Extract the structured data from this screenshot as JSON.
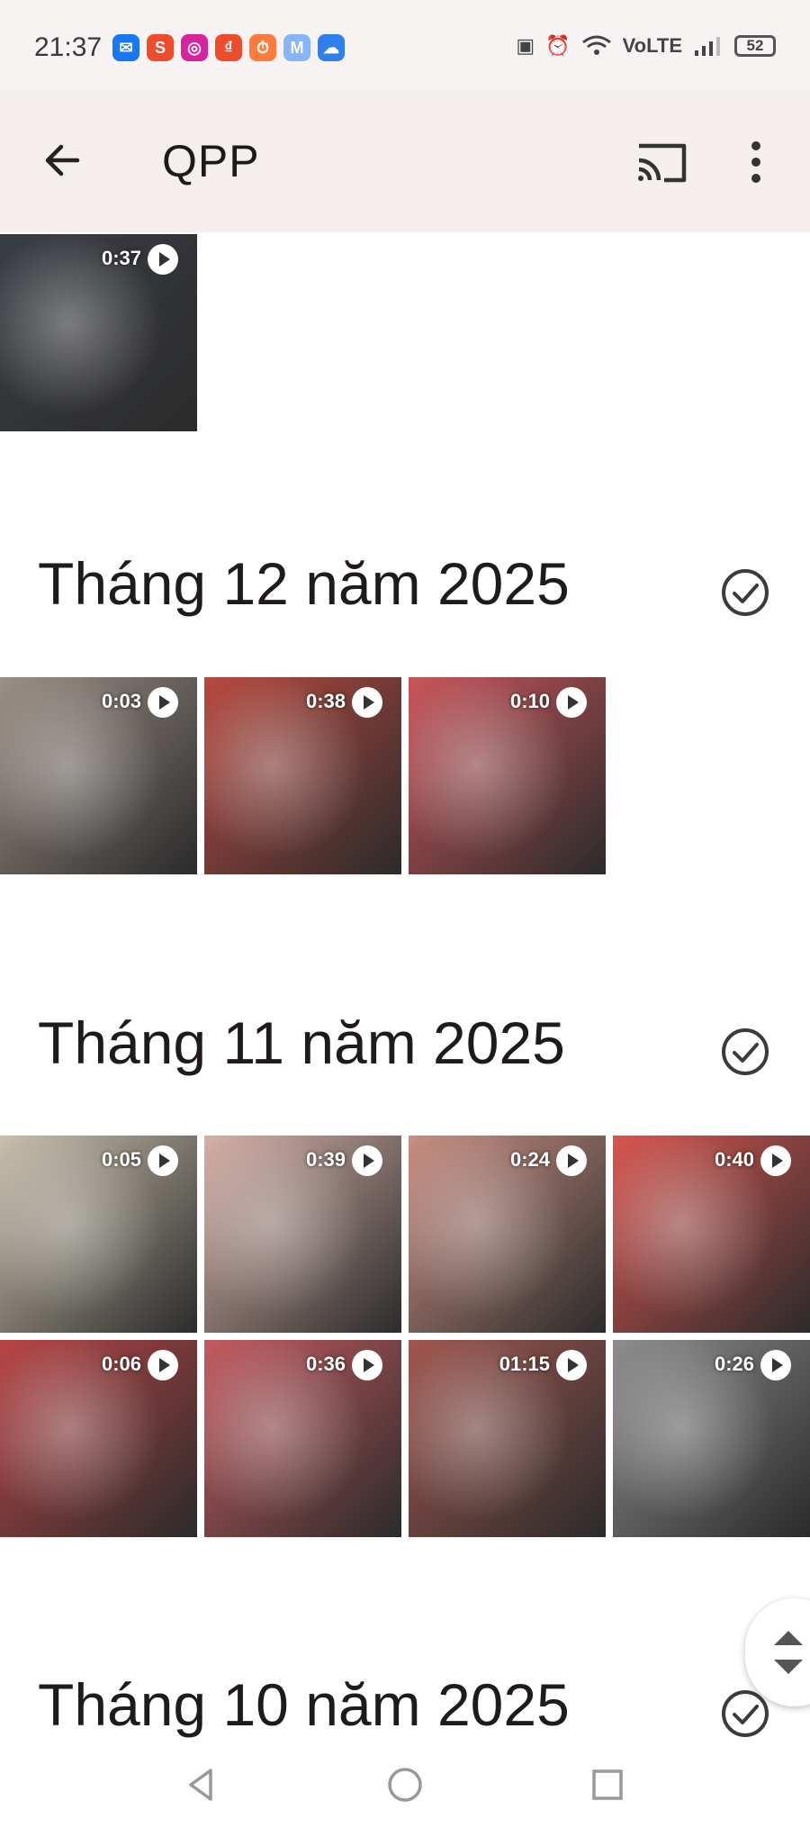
{
  "status_bar": {
    "time": "21:37",
    "network": "VoLTE",
    "battery": "52",
    "app_icons": [
      {
        "name": "messenger-icon",
        "glyph": "✉",
        "color": "#1877f2"
      },
      {
        "name": "shopee-icon",
        "glyph": "S",
        "color": "#ee4d2d"
      },
      {
        "name": "instagram-icon",
        "glyph": "◎",
        "color": "#d6249f"
      },
      {
        "name": "shopeepay-icon",
        "glyph": "₫",
        "color": "#ee4d2d"
      },
      {
        "name": "timer-icon",
        "glyph": "⏱",
        "color": "#ff7a3d"
      },
      {
        "name": "mail-icon",
        "glyph": "M",
        "color": "#8ab4f8"
      },
      {
        "name": "cloud-icon",
        "glyph": "☁",
        "color": "#2f80ed"
      }
    ]
  },
  "app_bar": {
    "title": "QPP"
  },
  "sections": [
    {
      "month": "",
      "items": [
        {
          "duration": "0:37",
          "color": "#3a3d44"
        }
      ]
    },
    {
      "month": "Tháng 12 năm 2025",
      "items": [
        {
          "duration": "0:03",
          "color": "#9b8f86"
        },
        {
          "duration": "0:38",
          "color": "#b8493f"
        },
        {
          "duration": "0:10",
          "color": "#c9555a"
        }
      ]
    },
    {
      "month": "Tháng 11 năm 2025",
      "items": [
        {
          "duration": "0:05",
          "color": "#c9c0ad"
        },
        {
          "duration": "0:39",
          "color": "#d6b1a8"
        },
        {
          "duration": "0:24",
          "color": "#c98f82"
        },
        {
          "duration": "0:40",
          "color": "#d8554f"
        },
        {
          "duration": "0:06",
          "color": "#b94546"
        },
        {
          "duration": "0:36",
          "color": "#c45b60"
        },
        {
          "duration": "01:15",
          "color": "#a0574f"
        },
        {
          "duration": "0:26",
          "color": "#8f8d8e"
        }
      ]
    },
    {
      "month": "Tháng 10 năm 2025",
      "items": []
    }
  ]
}
